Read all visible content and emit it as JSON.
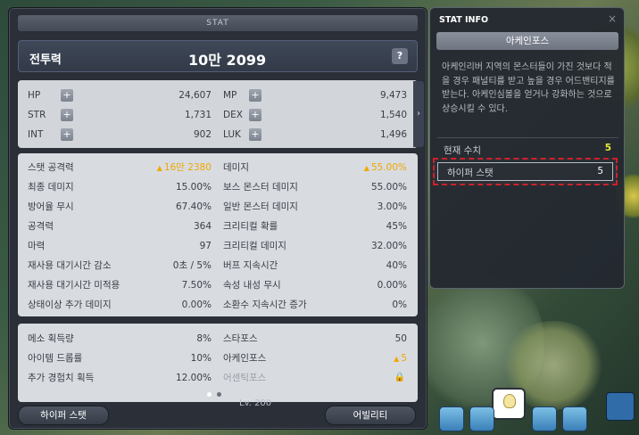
{
  "stat_window": {
    "title": "STAT",
    "combat_power_label": "전투력",
    "combat_power_value": "10만 2099",
    "help_label": "?",
    "base_stats": [
      {
        "label": "HP",
        "value": "24,607"
      },
      {
        "label": "MP",
        "value": "9,473"
      },
      {
        "label": "STR",
        "value": "1,731"
      },
      {
        "label": "DEX",
        "value": "1,540"
      },
      {
        "label": "INT",
        "value": "902"
      },
      {
        "label": "LUK",
        "value": "1,496"
      }
    ],
    "expand_arrow": "›",
    "detail_stats": [
      {
        "label": "스탯 공격력",
        "value": "16만 2380",
        "highlight": true
      },
      {
        "label": "데미지",
        "value": "55.00%",
        "highlight": true
      },
      {
        "label": "최종 데미지",
        "value": "15.00%"
      },
      {
        "label": "보스 몬스터 데미지",
        "value": "55.00%"
      },
      {
        "label": "방어율 무시",
        "value": "67.40%"
      },
      {
        "label": "일반 몬스터 데미지",
        "value": "3.00%"
      },
      {
        "label": "공격력",
        "value": "364"
      },
      {
        "label": "크리티컬 확률",
        "value": "45%"
      },
      {
        "label": "마력",
        "value": "97"
      },
      {
        "label": "크리티컬 데미지",
        "value": "32.00%"
      },
      {
        "label": "재사용 대기시간 감소",
        "value": "0초 / 5%"
      },
      {
        "label": "버프 지속시간",
        "value": "40%"
      },
      {
        "label": "재사용 대기시간 미적용",
        "value": "7.50%"
      },
      {
        "label": "속성 내성 무시",
        "value": "0.00%"
      },
      {
        "label": "상태이상 추가 데미지",
        "value": "0.00%"
      },
      {
        "label": "소환수 지속시간 증가",
        "value": "0%"
      }
    ],
    "misc_stats": [
      {
        "label": "메소 획득량",
        "value": "8%"
      },
      {
        "label": "스타포스",
        "value": "50"
      },
      {
        "label": "아이템 드롭률",
        "value": "10%"
      },
      {
        "label": "아케인포스",
        "value": "5",
        "highlight": true
      },
      {
        "label": "추가 경험치 획득",
        "value": "12.00%"
      },
      {
        "label": "어센틱포스",
        "value": "🔒",
        "locked": true
      }
    ],
    "page_current": 1,
    "page_total": 2,
    "hyper_stat_button": "하이퍼 스탯",
    "ability_button": "어빌리티"
  },
  "stat_info": {
    "title": "STAT INFO",
    "close_label": "×",
    "header": "아케인포스",
    "description": "아케인리버 지역의 몬스터들이 가진 것보다 적을 경우 패널티를 받고 높을 경우 어드밴티지를 받는다. 아케인심볼을 얻거나 강화하는 것으로 상승시킬 수 있다.",
    "current_label": "현재 수치",
    "current_value": "5",
    "hyper_stat_label": "하이퍼 스탯",
    "hyper_stat_value": "5"
  },
  "hud": {
    "level_text": "Lv. 200"
  },
  "colors": {
    "highlight": "#f0a800",
    "current_value": "#e8e83a",
    "dashed_border": "#d0202a"
  }
}
